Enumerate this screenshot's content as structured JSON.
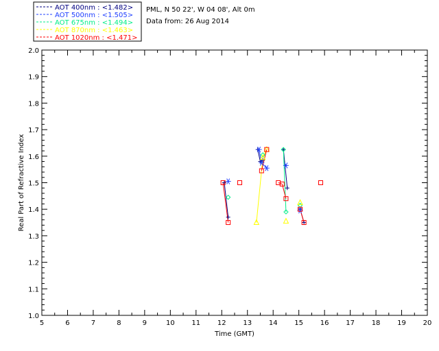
{
  "info": {
    "location": "PML, N 50 22', W 04 08', Alt 0m",
    "date_line": "Data from: 26 Aug 2014"
  },
  "chart_data": {
    "type": "line",
    "title": "",
    "xlabel": "Time (GMT)",
    "ylabel": "Real Part of Refractive Index",
    "xlim": [
      5,
      20
    ],
    "ylim": [
      1.0,
      2.0
    ],
    "xticks": [
      5,
      6,
      7,
      8,
      9,
      10,
      11,
      12,
      13,
      14,
      15,
      16,
      17,
      18,
      19,
      20
    ],
    "yticks": [
      1.0,
      1.1,
      1.2,
      1.3,
      1.4,
      1.5,
      1.6,
      1.7,
      1.8,
      1.9,
      2.0
    ],
    "ytick_labels": [
      "1.0",
      "1.1",
      "1.2",
      "1.3",
      "1.4",
      "1.5",
      "1.6",
      "1.7",
      "1.8",
      "1.9",
      "2.0"
    ],
    "grid": false,
    "legend_position": "top-left outside",
    "series": [
      {
        "name": "AOT  400nm : <1.482>",
        "color": "#000080",
        "marker": "plus",
        "points": [
          [
            12.1,
            1.5
          ],
          [
            12.25,
            1.37
          ],
          [
            13.4,
            1.625
          ],
          [
            13.5,
            1.58
          ],
          [
            13.6,
            1.585
          ],
          [
            14.4,
            1.625
          ],
          [
            14.55,
            1.48
          ],
          [
            15.05,
            1.4
          ],
          [
            15.2,
            1.35
          ]
        ]
      },
      {
        "name": "AOT  500nm : <1.505>",
        "color": "#2040ff",
        "marker": "asterisk",
        "points": [
          [
            12.25,
            1.505
          ],
          [
            13.45,
            1.625
          ],
          [
            13.55,
            1.575
          ],
          [
            13.75,
            1.555
          ],
          [
            14.5,
            1.565
          ],
          [
            15.05,
            1.395
          ]
        ]
      },
      {
        "name": "AOT  675nm : <1.494>",
        "color": "#00ee88",
        "marker": "diamond",
        "points": [
          [
            12.25,
            1.445
          ],
          [
            13.6,
            1.605
          ],
          [
            14.4,
            1.625
          ],
          [
            14.5,
            1.39
          ],
          [
            15.05,
            1.415
          ]
        ]
      },
      {
        "name": "AOT  870nm : <1.463>",
        "color": "#ffff00",
        "marker": "triangle",
        "points": [
          [
            13.35,
            1.35
          ],
          [
            13.6,
            1.595
          ],
          [
            13.75,
            1.625
          ],
          [
            14.5,
            1.355
          ],
          [
            15.05,
            1.425
          ]
        ]
      },
      {
        "name": "AOT 1020nm : <1.471>",
        "color": "#ff0000",
        "marker": "square",
        "points": [
          [
            12.05,
            1.5
          ],
          [
            12.25,
            1.35
          ],
          [
            12.7,
            1.5
          ],
          [
            13.55,
            1.545
          ],
          [
            13.75,
            1.625
          ],
          [
            14.2,
            1.5
          ],
          [
            14.35,
            1.495
          ],
          [
            14.5,
            1.44
          ],
          [
            15.05,
            1.4
          ],
          [
            15.2,
            1.35
          ],
          [
            15.85,
            1.5
          ]
        ]
      }
    ]
  }
}
